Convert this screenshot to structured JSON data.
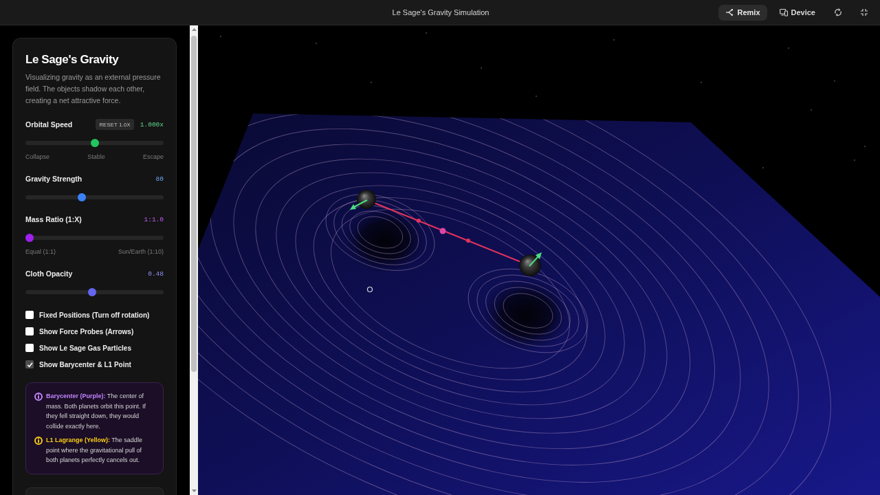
{
  "topbar": {
    "title": "Le Sage's Gravity Simulation",
    "buttons": [
      {
        "kind": "primary",
        "label": "Remix"
      },
      {
        "kind": "plain",
        "label": "Device"
      }
    ]
  },
  "panel": {
    "title": "Le Sage's Gravity",
    "description": "Visualizing gravity as an external pressure field. The objects shadow each other, creating a net attractive force.",
    "sliders": [
      {
        "label": "Orbital Speed",
        "reset_button": "RESET 1.0X",
        "reading": "1.000x",
        "color": "#22c55e",
        "level": 0.5,
        "scale_labels": [
          "Collapse",
          "Stable",
          "Escape"
        ]
      },
      {
        "label": "Gravity Strength",
        "reading": "80",
        "color": "#3b82f6",
        "level": 0.4
      },
      {
        "label": "Mass Ratio (1:X)",
        "reading": "1:1.0",
        "color": "#a020f0",
        "level": 0,
        "scale_labels": [
          "Equal (1:1)",
          "Sun/Earth (1:10)"
        ]
      },
      {
        "label": "Cloth Opacity",
        "reading": "0.48",
        "color": "#6366f1",
        "level": 0.48
      }
    ],
    "checkboxes": [
      {
        "label": "Fixed Positions (Turn off rotation)",
        "checked": false
      },
      {
        "label": "Show Force Probes (Arrows)",
        "checked": false
      },
      {
        "label": "Show Le Sage Gas Particles",
        "checked": false
      },
      {
        "label": "Show Barycenter & L1 Point",
        "checked": true
      }
    ],
    "notes": [
      {
        "text": "**Barycenter (Purple):** The center of mass. Both planets orbit this point. If they fell straight down, they would collide exactly here.",
        "color": "#c084fc"
      },
      {
        "text": "**L1 Lagrange (Yellow):** The saddle point where the gravitational pull of both planets perfectly cancels out.",
        "color": "#facc15"
      }
    ]
  }
}
